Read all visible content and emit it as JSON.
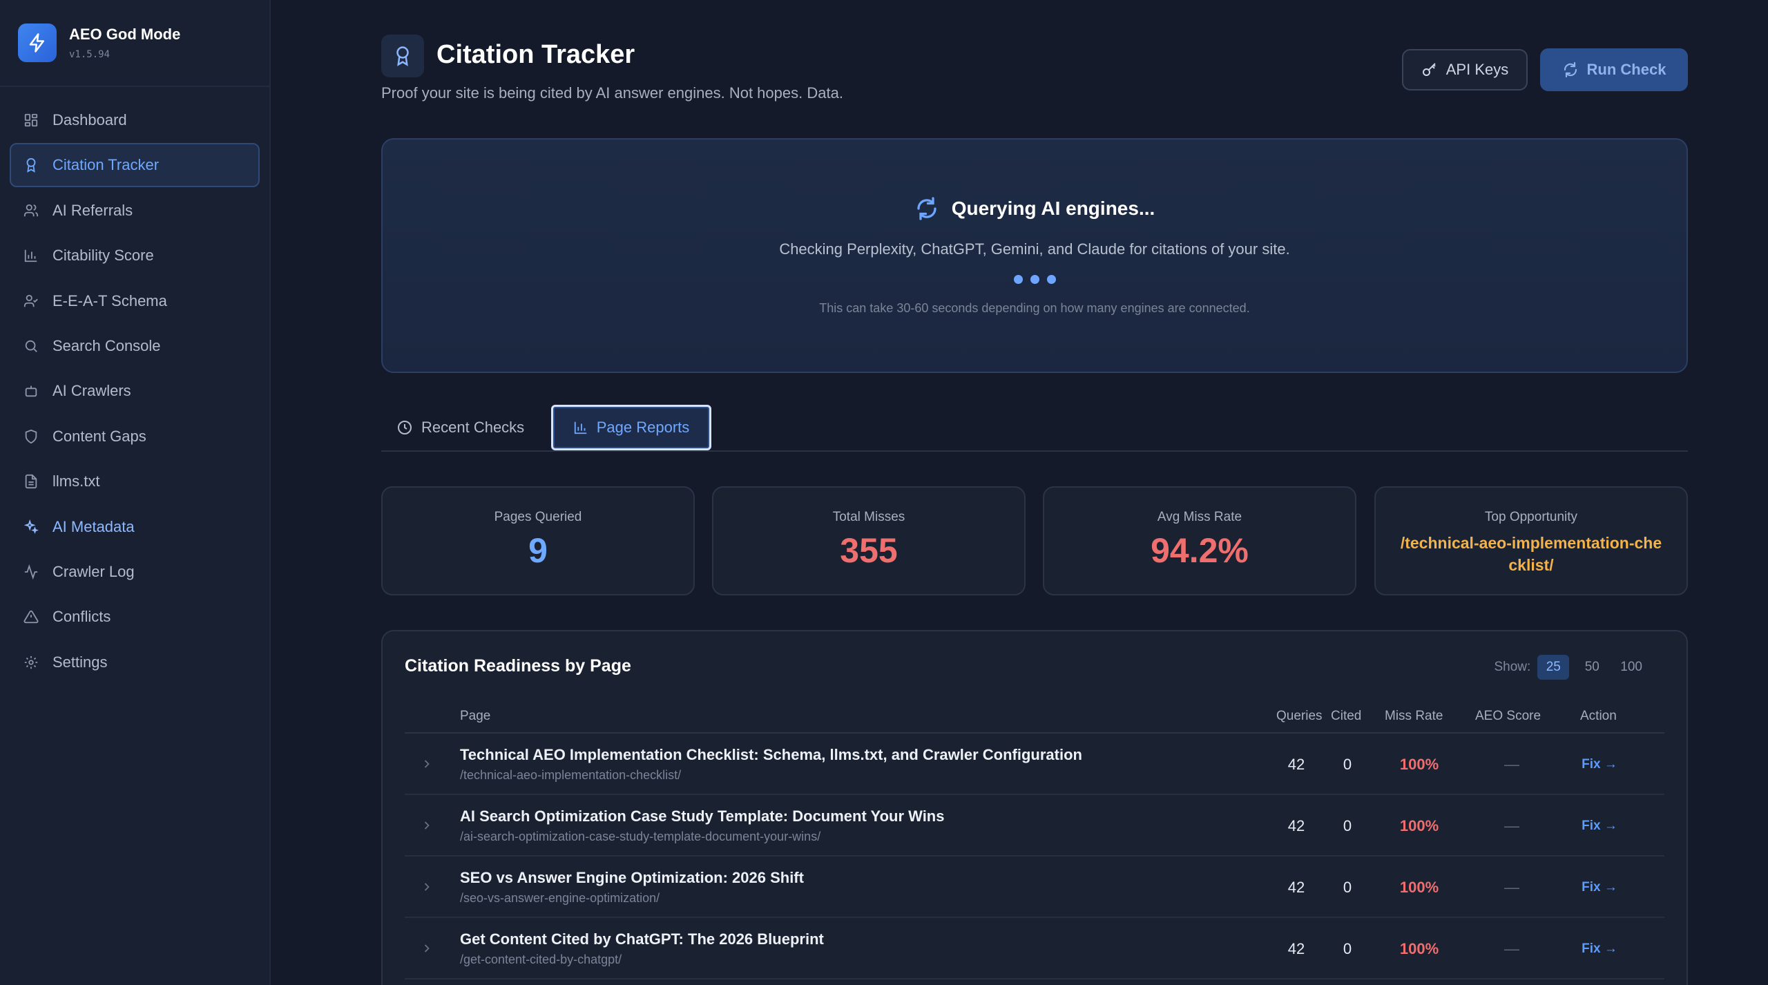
{
  "brand": {
    "name": "AEO God Mode",
    "version": "v1.5.94"
  },
  "nav": [
    {
      "label": "Dashboard",
      "icon": "grid-icon"
    },
    {
      "label": "Citation Tracker",
      "icon": "award-icon"
    },
    {
      "label": "AI Referrals",
      "icon": "users-icon"
    },
    {
      "label": "Citability Score",
      "icon": "bar-chart-icon"
    },
    {
      "label": "E-E-A-T Schema",
      "icon": "user-check-icon"
    },
    {
      "label": "Search Console",
      "icon": "search-icon"
    },
    {
      "label": "AI Crawlers",
      "icon": "bot-icon"
    },
    {
      "label": "Content Gaps",
      "icon": "shield-icon"
    },
    {
      "label": "llms.txt",
      "icon": "file-icon"
    },
    {
      "label": "AI Metadata",
      "icon": "sparkles-icon"
    },
    {
      "label": "Crawler Log",
      "icon": "activity-icon"
    },
    {
      "label": "Conflicts",
      "icon": "alert-triangle-icon"
    },
    {
      "label": "Settings",
      "icon": "gear-icon"
    }
  ],
  "header": {
    "title": "Citation Tracker",
    "subtitle": "Proof your site is being cited by AI answer engines. Not hopes. Data.",
    "api_keys_label": "API Keys",
    "run_check_label": "Run Check"
  },
  "query": {
    "title": "Querying AI engines...",
    "description": "Checking Perplexity, ChatGPT, Gemini, and Claude for citations of your site.",
    "note": "This can take 30-60 seconds depending on how many engines are connected."
  },
  "tabs": {
    "recent": "Recent Checks",
    "reports": "Page Reports"
  },
  "stats": {
    "pages_queried": {
      "label": "Pages Queried",
      "value": "9"
    },
    "total_misses": {
      "label": "Total Misses",
      "value": "355"
    },
    "avg_miss_rate": {
      "label": "Avg Miss Rate",
      "value": "94.2%"
    },
    "top_opportunity": {
      "label": "Top Opportunity",
      "value": "/technical-aeo-implementation-checklist/"
    }
  },
  "colors": {
    "blue": "#6fa8ff",
    "red": "#ef6e6e",
    "orange": "#f3b24a"
  },
  "table": {
    "title": "Citation Readiness by Page",
    "show_label": "Show:",
    "show_options": [
      "25",
      "50",
      "100"
    ],
    "columns": {
      "page": "Page",
      "queries": "Queries",
      "cited": "Cited",
      "miss_rate": "Miss Rate",
      "aeo_score": "AEO Score",
      "action": "Action"
    },
    "rows": [
      {
        "title": "Technical AEO Implementation Checklist: Schema, llms.txt, and Crawler Configuration",
        "path": "/technical-aeo-implementation-checklist/",
        "queries": "42",
        "cited": "0",
        "miss_rate": "100%",
        "aeo_score": "—",
        "action": "Fix →"
      },
      {
        "title": "AI Search Optimization Case Study Template: Document Your Wins",
        "path": "/ai-search-optimization-case-study-template-document-your-wins/",
        "queries": "42",
        "cited": "0",
        "miss_rate": "100%",
        "aeo_score": "—",
        "action": "Fix →"
      },
      {
        "title": "SEO vs Answer Engine Optimization: 2026 Shift",
        "path": "/seo-vs-answer-engine-optimization/",
        "queries": "42",
        "cited": "0",
        "miss_rate": "100%",
        "aeo_score": "—",
        "action": "Fix →"
      },
      {
        "title": "Get Content Cited by ChatGPT: The 2026 Blueprint",
        "path": "/get-content-cited-by-chatgpt/",
        "queries": "42",
        "cited": "0",
        "miss_rate": "100%",
        "aeo_score": "—",
        "action": "Fix →"
      }
    ]
  }
}
